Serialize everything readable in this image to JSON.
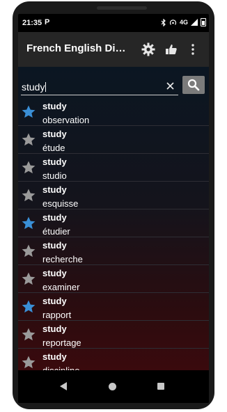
{
  "status_bar": {
    "time": "21:35",
    "notif_icon": "P",
    "signal": "4G"
  },
  "toolbar": {
    "title": "French English Dicti...",
    "settings_icon": "gear-icon",
    "like_icon": "thumbs-up-icon",
    "more_icon": "more-vertical-icon"
  },
  "search": {
    "value": "study",
    "clear_icon": "close-icon",
    "button_icon": "search-icon"
  },
  "colors": {
    "star_favorite": "#3a8fd6",
    "star_default": "#9a9a9a"
  },
  "results": [
    {
      "word": "study",
      "translation": "observation",
      "favorite": true
    },
    {
      "word": "study",
      "translation": "étude",
      "favorite": false
    },
    {
      "word": "study",
      "translation": "studio",
      "favorite": false
    },
    {
      "word": "study",
      "translation": "esquisse",
      "favorite": false
    },
    {
      "word": "study",
      "translation": "étudier",
      "favorite": true
    },
    {
      "word": "study",
      "translation": "recherche",
      "favorite": false
    },
    {
      "word": "study",
      "translation": "examiner",
      "favorite": false
    },
    {
      "word": "study",
      "translation": "rapport",
      "favorite": true
    },
    {
      "word": "study",
      "translation": "reportage",
      "favorite": false
    },
    {
      "word": "study",
      "translation": "discipline",
      "favorite": false
    }
  ]
}
